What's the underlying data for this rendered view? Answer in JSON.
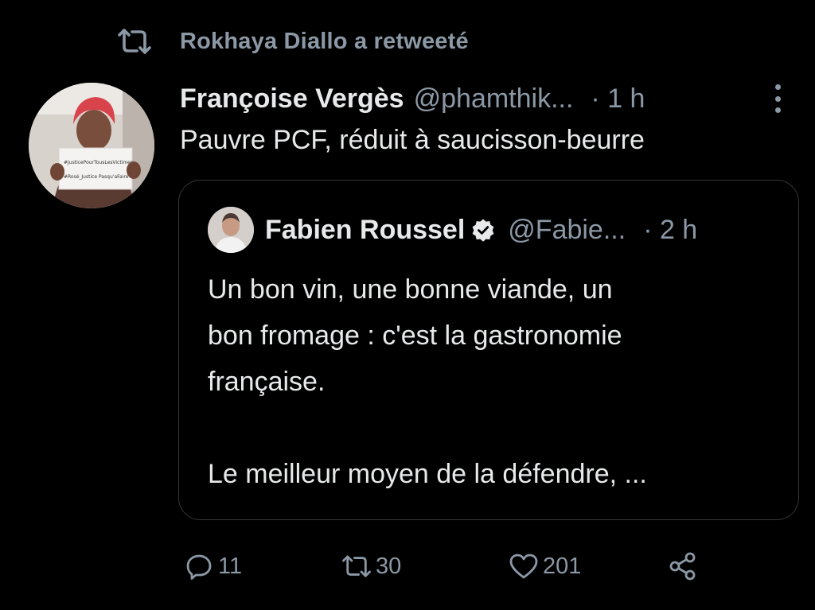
{
  "retweet_context": {
    "label": "Rokhaya Diallo a retweeté",
    "icon": "retweet-icon"
  },
  "tweet": {
    "author_name": "Françoise Vergès",
    "author_handle": "@phamthik...",
    "time": "· 1 h",
    "text": "Pauvre PCF, réduit à saucisson-beurre"
  },
  "quote": {
    "author_name": "Fabien Roussel",
    "author_handle": "@Fabie...",
    "time": "· 2 h",
    "lines": [
      "Un bon vin, une bonne viande, un",
      "bon fromage : c'est la gastronomie",
      "française."
    ],
    "paragraph2": "Le meilleur moyen de la défendre, ..."
  },
  "avatar_sign": {
    "line1": "#JusticePourTousLesVictimes",
    "line2": "#Rosé_Justice Pasqu'aFaire"
  },
  "actions": {
    "replies": "11",
    "retweets": "30",
    "likes": "201"
  },
  "colors": {
    "background": "#000000",
    "text_primary": "#e7e9ea",
    "text_secondary": "#8b98a5",
    "border": "#333639"
  }
}
